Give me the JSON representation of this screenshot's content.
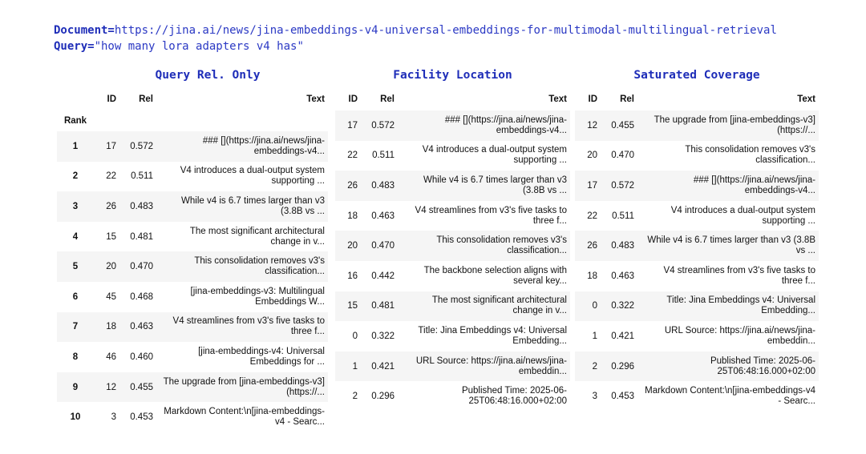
{
  "header": {
    "document_key": "Document=",
    "document_value": "https://jina.ai/news/jina-embeddings-v4-universal-embeddings-for-multimodal-multilingual-retrieval",
    "query_key": "Query=",
    "query_value": "\"how many lora adapters v4 has\""
  },
  "columns": {
    "rank": "Rank",
    "id": "ID",
    "rel": "Rel",
    "text": "Text"
  },
  "blocks": [
    {
      "title": "Query Rel. Only",
      "rows": [
        {
          "id": "17",
          "rel": "0.572",
          "text": "### [](https://jina.ai/news/jina-embeddings-v4..."
        },
        {
          "id": "22",
          "rel": "0.511",
          "text": "V4 introduces a dual-output system supporting ..."
        },
        {
          "id": "26",
          "rel": "0.483",
          "text": "While v4 is 6.7 times larger than v3 (3.8B vs ..."
        },
        {
          "id": "15",
          "rel": "0.481",
          "text": "The most significant architectural change in v..."
        },
        {
          "id": "20",
          "rel": "0.470",
          "text": "This consolidation removes v3's classification..."
        },
        {
          "id": "45",
          "rel": "0.468",
          "text": "[jina-embeddings-v3: Multilingual Embeddings W..."
        },
        {
          "id": "18",
          "rel": "0.463",
          "text": "V4 streamlines from v3's five tasks to three f..."
        },
        {
          "id": "46",
          "rel": "0.460",
          "text": "[jina-embeddings-v4: Universal Embeddings for ..."
        },
        {
          "id": "12",
          "rel": "0.455",
          "text": "The upgrade from [jina-embeddings-v3](https://..."
        },
        {
          "id": "3",
          "rel": "0.453",
          "text": "Markdown Content:\\n[jina-embeddings-v4 - Searc..."
        }
      ]
    },
    {
      "title": "Facility Location",
      "rows": [
        {
          "id": "17",
          "rel": "0.572",
          "text": "### [](https://jina.ai/news/jina-embeddings-v4..."
        },
        {
          "id": "22",
          "rel": "0.511",
          "text": "V4 introduces a dual-output system supporting ..."
        },
        {
          "id": "26",
          "rel": "0.483",
          "text": "While v4 is 6.7 times larger than v3 (3.8B vs ..."
        },
        {
          "id": "18",
          "rel": "0.463",
          "text": "V4 streamlines from v3's five tasks to three f..."
        },
        {
          "id": "20",
          "rel": "0.470",
          "text": "This consolidation removes v3's classification..."
        },
        {
          "id": "16",
          "rel": "0.442",
          "text": "The backbone selection aligns with several key..."
        },
        {
          "id": "15",
          "rel": "0.481",
          "text": "The most significant architectural change in v..."
        },
        {
          "id": "0",
          "rel": "0.322",
          "text": "Title: Jina Embeddings v4: Universal Embedding..."
        },
        {
          "id": "1",
          "rel": "0.421",
          "text": "URL Source: https://jina.ai/news/jina-embeddin..."
        },
        {
          "id": "2",
          "rel": "0.296",
          "text": "Published Time: 2025-06-25T06:48:16.000+02:00"
        }
      ]
    },
    {
      "title": "Saturated Coverage",
      "rows": [
        {
          "id": "12",
          "rel": "0.455",
          "text": "The upgrade from [jina-embeddings-v3](https://..."
        },
        {
          "id": "20",
          "rel": "0.470",
          "text": "This consolidation removes v3's classification..."
        },
        {
          "id": "17",
          "rel": "0.572",
          "text": "### [](https://jina.ai/news/jina-embeddings-v4..."
        },
        {
          "id": "22",
          "rel": "0.511",
          "text": "V4 introduces a dual-output system supporting ..."
        },
        {
          "id": "26",
          "rel": "0.483",
          "text": "While v4 is 6.7 times larger than v3 (3.8B vs ..."
        },
        {
          "id": "18",
          "rel": "0.463",
          "text": "V4 streamlines from v3's five tasks to three f..."
        },
        {
          "id": "0",
          "rel": "0.322",
          "text": "Title: Jina Embeddings v4: Universal Embedding..."
        },
        {
          "id": "1",
          "rel": "0.421",
          "text": "URL Source: https://jina.ai/news/jina-embeddin..."
        },
        {
          "id": "2",
          "rel": "0.296",
          "text": "Published Time: 2025-06-25T06:48:16.000+02:00"
        },
        {
          "id": "3",
          "rel": "0.453",
          "text": "Markdown Content:\\n[jina-embeddings-v4 - Searc..."
        }
      ]
    }
  ],
  "ranks": [
    "1",
    "2",
    "3",
    "4",
    "5",
    "6",
    "7",
    "8",
    "9",
    "10"
  ]
}
